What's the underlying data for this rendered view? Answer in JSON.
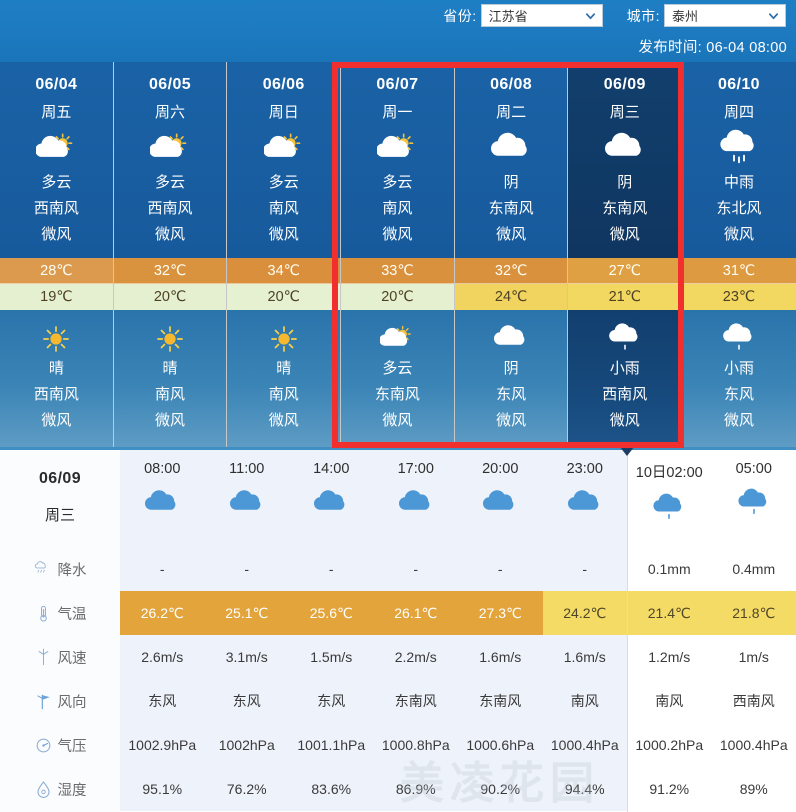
{
  "header": {
    "province_label": "省份:",
    "province_value": "江苏省",
    "city_label": "城市:",
    "city_value": "泰州",
    "publish_time": "发布时间: 06-04 08:00",
    "accent_color": "#1d7ac0",
    "highlight_color": "#f22f2f"
  },
  "forecast": {
    "days": [
      {
        "date": "06/04",
        "weekday": "周五",
        "day_icon": "partly-cloudy-icon",
        "day_cond": "多云",
        "day_wind_dir": "西南风",
        "day_wind_power": "微风",
        "high": "28℃",
        "low": "19℃",
        "high_color": "#dc9a4e",
        "low_color": "#e4f0cf",
        "night_icon": "sunny-icon",
        "night_cond": "晴",
        "night_wind_dir": "西南风",
        "night_wind_power": "微风",
        "highlighted": false,
        "dark": false
      },
      {
        "date": "06/05",
        "weekday": "周六",
        "day_icon": "partly-cloudy-icon",
        "day_cond": "多云",
        "day_wind_dir": "西南风",
        "day_wind_power": "微风",
        "high": "32℃",
        "low": "20℃",
        "high_color": "#d9933f",
        "low_color": "#e4f0cf",
        "night_icon": "sunny-icon",
        "night_cond": "晴",
        "night_wind_dir": "南风",
        "night_wind_power": "微风",
        "highlighted": false,
        "dark": false
      },
      {
        "date": "06/06",
        "weekday": "周日",
        "day_icon": "partly-cloudy-icon",
        "day_cond": "多云",
        "day_wind_dir": "南风",
        "day_wind_power": "微风",
        "high": "34℃",
        "low": "20℃",
        "high_color": "#d98f3c",
        "low_color": "#e6f1d2",
        "night_icon": "sunny-icon",
        "night_cond": "晴",
        "night_wind_dir": "南风",
        "night_wind_power": "微风",
        "highlighted": false,
        "dark": false
      },
      {
        "date": "06/07",
        "weekday": "周一",
        "day_icon": "partly-cloudy-icon",
        "day_cond": "多云",
        "day_wind_dir": "南风",
        "day_wind_power": "微风",
        "high": "33℃",
        "low": "20℃",
        "high_color": "#d9913d",
        "low_color": "#e4f0cf",
        "night_icon": "partly-cloudy-icon",
        "night_cond": "多云",
        "night_wind_dir": "东南风",
        "night_wind_power": "微风",
        "highlighted": true,
        "dark": false
      },
      {
        "date": "06/08",
        "weekday": "周二",
        "day_icon": "cloudy-icon",
        "day_cond": "阴",
        "day_wind_dir": "东南风",
        "day_wind_power": "微风",
        "high": "32℃",
        "low": "24℃",
        "high_color": "#d9913d",
        "low_color": "#f0d45f",
        "night_icon": "cloudy-icon",
        "night_cond": "阴",
        "night_wind_dir": "东风",
        "night_wind_power": "微风",
        "highlighted": true,
        "dark": false
      },
      {
        "date": "06/09",
        "weekday": "周三",
        "day_icon": "cloudy-icon",
        "day_cond": "阴",
        "day_wind_dir": "东南风",
        "day_wind_power": "微风",
        "high": "27℃",
        "low": "21℃",
        "high_color": "#dfa043",
        "low_color": "#f2d761",
        "night_icon": "light-rain-icon",
        "night_cond": "小雨",
        "night_wind_dir": "西南风",
        "night_wind_power": "微风",
        "highlighted": true,
        "dark": true
      },
      {
        "date": "06/10",
        "weekday": "周四",
        "day_icon": "moderate-rain-icon",
        "day_cond": "中雨",
        "day_wind_dir": "东北风",
        "day_wind_power": "微风",
        "high": "31℃",
        "low": "23℃",
        "high_color": "#dd9a41",
        "low_color": "#f2d761",
        "night_icon": "light-rain-icon",
        "night_cond": "小雨",
        "night_wind_dir": "东风",
        "night_wind_power": "微风",
        "highlighted": false,
        "dark": false
      }
    ]
  },
  "hourly": {
    "date": "06/09",
    "weekday": "周三",
    "row_labels": [
      {
        "icon": "precipitation-icon",
        "label": "降水"
      },
      {
        "icon": "thermometer-icon",
        "label": "气温"
      },
      {
        "icon": "windspeed-icon",
        "label": "风速"
      },
      {
        "icon": "winddir-icon",
        "label": "风向"
      },
      {
        "icon": "pressure-icon",
        "label": "气压"
      },
      {
        "icon": "humidity-icon",
        "label": "湿度"
      }
    ],
    "columns": [
      {
        "time": "08:00",
        "icon": "cloudy-blue-icon",
        "precip": "-",
        "temp": "26.2℃",
        "temp_bg": "hot",
        "wind_speed": "2.6m/s",
        "wind_dir": "东风",
        "pressure": "1002.9hPa",
        "humidity": "95.1%",
        "next_day": false
      },
      {
        "time": "11:00",
        "icon": "cloudy-blue-icon",
        "precip": "-",
        "temp": "25.1℃",
        "temp_bg": "hot",
        "wind_speed": "3.1m/s",
        "wind_dir": "东风",
        "pressure": "1002hPa",
        "humidity": "76.2%",
        "next_day": false
      },
      {
        "time": "14:00",
        "icon": "cloudy-blue-icon",
        "precip": "-",
        "temp": "25.6℃",
        "temp_bg": "hot",
        "wind_speed": "1.5m/s",
        "wind_dir": "东风",
        "pressure": "1001.1hPa",
        "humidity": "83.6%",
        "next_day": false
      },
      {
        "time": "17:00",
        "icon": "cloudy-blue-icon",
        "precip": "-",
        "temp": "26.1℃",
        "temp_bg": "hot",
        "wind_speed": "2.2m/s",
        "wind_dir": "东南风",
        "pressure": "1000.8hPa",
        "humidity": "86.9%",
        "next_day": false
      },
      {
        "time": "20:00",
        "icon": "cloudy-blue-icon",
        "precip": "-",
        "temp": "27.3℃",
        "temp_bg": "hot",
        "wind_speed": "1.6m/s",
        "wind_dir": "东南风",
        "pressure": "1000.6hPa",
        "humidity": "90.2%",
        "next_day": false
      },
      {
        "time": "23:00",
        "icon": "cloudy-blue-icon",
        "precip": "-",
        "temp": "24.2℃",
        "temp_bg": "warm",
        "wind_speed": "1.6m/s",
        "wind_dir": "南风",
        "pressure": "1000.4hPa",
        "humidity": "94.4%",
        "next_day": false
      },
      {
        "time": "10日02:00",
        "icon": "light-rain-blue-icon",
        "precip": "0.1mm",
        "temp": "21.4℃",
        "temp_bg": "warm",
        "wind_speed": "1.2m/s",
        "wind_dir": "南风",
        "pressure": "1000.2hPa",
        "humidity": "91.2%",
        "next_day": true
      },
      {
        "time": "05:00",
        "icon": "light-rain-blue-icon",
        "precip": "0.4mm",
        "temp": "21.8℃",
        "temp_bg": "warm",
        "wind_speed": "1m/s",
        "wind_dir": "西南风",
        "pressure": "1000.4hPa",
        "humidity": "89%",
        "next_day": true
      }
    ]
  }
}
